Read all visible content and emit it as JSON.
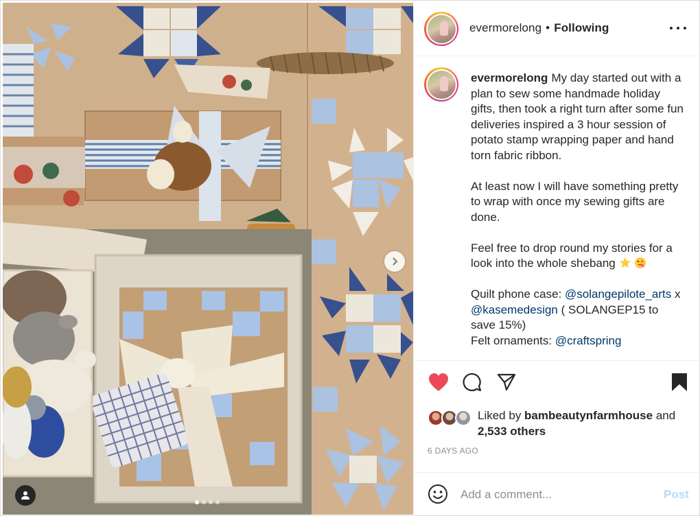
{
  "post": {
    "username": "evermorelong",
    "separator": "•",
    "follow_status": "Following",
    "caption": {
      "paragraphs": [
        "My day started out with a plan to sew some handmade holiday gifts, then took a right turn after some fun deliveries inspired a 3 hour session of potato stamp wrapping paper and hand torn fabric ribbon.",
        "At least now I will have something pretty to wrap with once my sewing gifts are done.",
        "Feel free to drop round my stories for a look into the whole shebang"
      ],
      "credit_1_label": "Quilt phone case: ",
      "credit_1_mention": "@solangepilote_arts",
      "credit_1_joiner": "x ",
      "credit_1_mention_2": "@kasemedesign",
      "credit_1_suffix": " ( SOLANGEP15 to save 15%)",
      "credit_2_label": "Felt ornaments: ",
      "credit_2_mention": "@craftspring"
    },
    "likes": {
      "prefix": "Liked by ",
      "user": "bambeautynfarmhouse",
      "conjunction": " and",
      "others": "2,533 others"
    },
    "timestamp": "6 DAYS AGO"
  },
  "carousel": {
    "slide_count": 4,
    "active_index": 0
  },
  "icons": {
    "like": "heart-icon",
    "comment": "comment-icon",
    "share": "share-icon",
    "save": "bookmark-icon",
    "emoji": "smile-icon",
    "more": "more-icon",
    "next": "chevron-right-icon",
    "tag": "user-tag-icon"
  },
  "colors": {
    "like_active": "#ed4956",
    "mention": "#00376b",
    "post_disabled": "#b3dbff",
    "timestamp": "#8e8e8e"
  },
  "comment_box": {
    "placeholder": "Add a comment...",
    "post_label": "Post"
  }
}
